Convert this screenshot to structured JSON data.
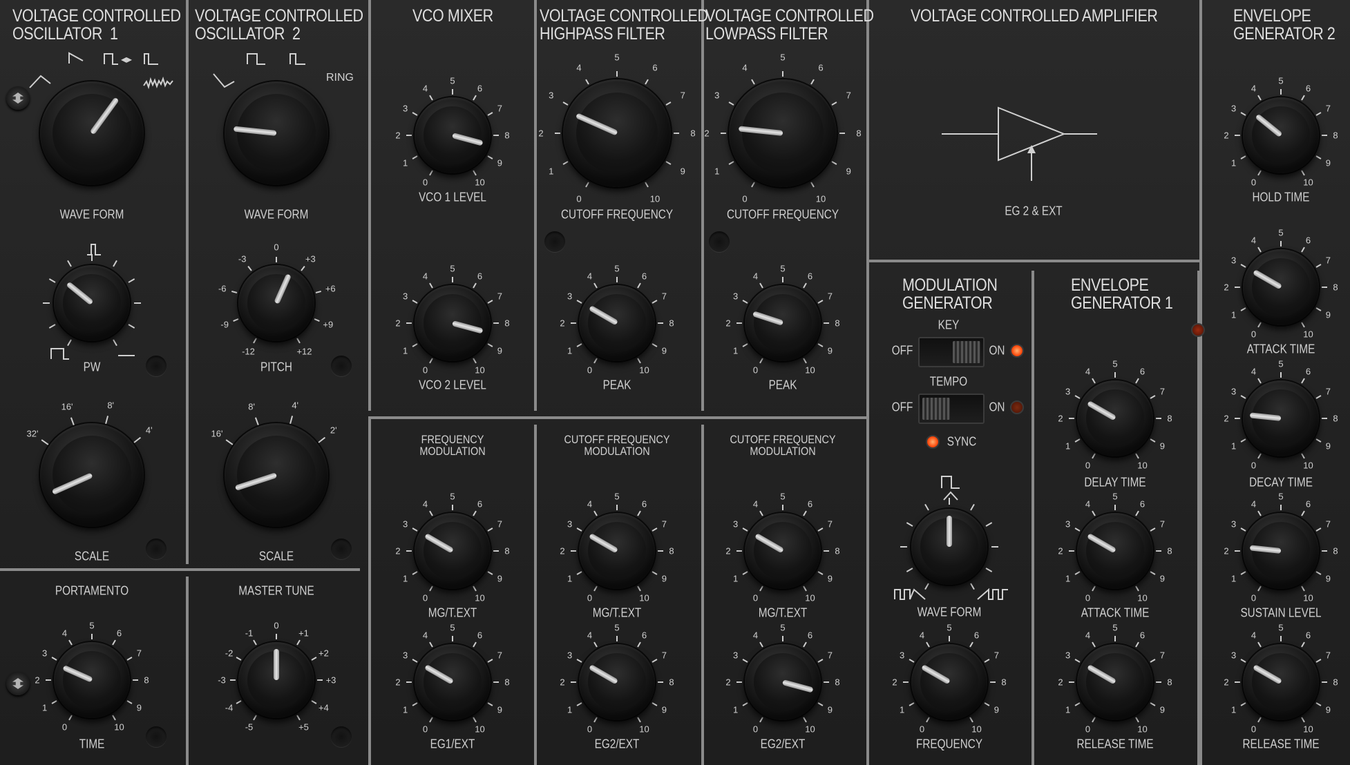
{
  "colors": {
    "panel": "#232323",
    "divider": "#8a8a8a",
    "led_on": "#ff5a1a",
    "led_off": "#5a1a0a"
  },
  "sections": {
    "vco1": "VOLTAGE CONTROLLED\nOSCILLATOR  1",
    "vco2": "VOLTAGE CONTROLLED\nOSCILLATOR  2",
    "vco_mixer": "VCO MIXER",
    "vchpf": "VOLTAGE CONTROLLED\nHIGHPASS FILTER",
    "vclpf": "VOLTAGE CONTROLLED\nLOWPASS FILTER",
    "vca": "VOLTAGE CONTROLLED AMPLIFIER",
    "eg2": "ENVELOPE\nGENERATOR 2",
    "mg": "MODULATION\nGENERATOR",
    "eg1": "ENVELOPE\nGENERATOR 1",
    "freq_mod": "FREQUENCY\nMODULATION",
    "cutoff_mod_1": "CUTOFF FREQUENCY\nMODULATION",
    "cutoff_mod_2": "CUTOFF FREQUENCY\nMODULATION"
  },
  "vca_diagram_label": "EG 2 & EXT",
  "knobs": {
    "vco1_waveform": {
      "label": "WAVE FORM"
    },
    "vco1_pw": {
      "label": "PW"
    },
    "vco1_scale": {
      "label": "SCALE",
      "marks": [
        "32'",
        "16'",
        "8'",
        "4'"
      ]
    },
    "vco2_waveform": {
      "label": "WAVE FORM",
      "marks": [
        "RING"
      ]
    },
    "vco2_pitch": {
      "label": "PITCH",
      "marks": [
        "-12",
        "-9",
        "-6",
        "-3",
        "0",
        "+3",
        "+6",
        "+9",
        "+12"
      ]
    },
    "vco2_scale": {
      "label": "SCALE",
      "marks": [
        "16'",
        "8'",
        "4'",
        "2'"
      ]
    },
    "portamento": {
      "label": "TIME",
      "title": "PORTAMENTO"
    },
    "master_tune": {
      "label": "",
      "title": "MASTER TUNE",
      "marks": [
        "-5",
        "-4",
        "-3",
        "-2",
        "-1",
        "0",
        "+1",
        "+2",
        "+3",
        "+4",
        "+5"
      ]
    },
    "vco1_level": {
      "label": "VCO 1 LEVEL"
    },
    "vco2_level": {
      "label": "VCO 2 LEVEL"
    },
    "hpf_cutoff": {
      "label": "CUTOFF FREQUENCY"
    },
    "hpf_peak": {
      "label": "PEAK"
    },
    "lpf_cutoff": {
      "label": "CUTOFF FREQUENCY"
    },
    "lpf_peak": {
      "label": "PEAK"
    },
    "fm_mg": {
      "label": "MG/T.EXT"
    },
    "fm_eg": {
      "label": "EG1/EXT"
    },
    "cm1_mg": {
      "label": "MG/T.EXT"
    },
    "cm1_eg": {
      "label": "EG2/EXT"
    },
    "cm2_mg": {
      "label": "MG/T.EXT"
    },
    "cm2_eg": {
      "label": "EG2/EXT"
    },
    "mg_waveform": {
      "label": "WAVE FORM"
    },
    "mg_frequency": {
      "label": "FREQUENCY"
    },
    "eg1_delay": {
      "label": "DELAY TIME"
    },
    "eg1_attack": {
      "label": "ATTACK TIME"
    },
    "eg1_release": {
      "label": "RELEASE TIME"
    },
    "eg2_hold": {
      "label": "HOLD TIME"
    },
    "eg2_attack": {
      "label": "ATTACK TIME"
    },
    "eg2_decay": {
      "label": "DECAY TIME"
    },
    "eg2_sustain": {
      "label": "SUSTAIN LEVEL"
    },
    "eg2_release": {
      "label": "RELEASE TIME"
    }
  },
  "dial_numbers": [
    "0",
    "1",
    "2",
    "3",
    "4",
    "5",
    "6",
    "7",
    "8",
    "9",
    "10"
  ],
  "switches": {
    "key": {
      "label": "KEY",
      "off": "OFF",
      "on": "ON",
      "state": "on"
    },
    "tempo": {
      "label": "TEMPO",
      "off": "OFF",
      "on": "ON",
      "state": "off"
    },
    "sync": {
      "label": "SYNC",
      "state": "on"
    }
  },
  "knob_values": {
    "vco1_waveform": 0.62,
    "vco1_pw": 0.33,
    "vco1_scale": 0.12,
    "vco2_waveform": 0.22,
    "vco2_pitch": 0.58,
    "vco2_scale": 0.14,
    "portamento": 0.28,
    "master_tune": 0.5,
    "vco1_level": 0.85,
    "vco2_level": 0.85,
    "hpf_cutoff": 0.28,
    "hpf_peak": 0.3,
    "lpf_cutoff": 0.22,
    "lpf_peak": 0.26,
    "fm_mg": 0.3,
    "fm_eg": 0.3,
    "cm1_mg": 0.3,
    "cm1_eg": 0.3,
    "cm2_mg": 0.3,
    "cm2_eg": 0.85,
    "mg_waveform": 0.5,
    "mg_frequency": 0.3,
    "eg1_delay": 0.3,
    "eg1_attack": 0.3,
    "eg1_release": 0.3,
    "eg2_hold": 0.33,
    "eg2_attack": 0.3,
    "eg2_decay": 0.22,
    "eg2_sustain": 0.22,
    "eg2_release": 0.3
  }
}
